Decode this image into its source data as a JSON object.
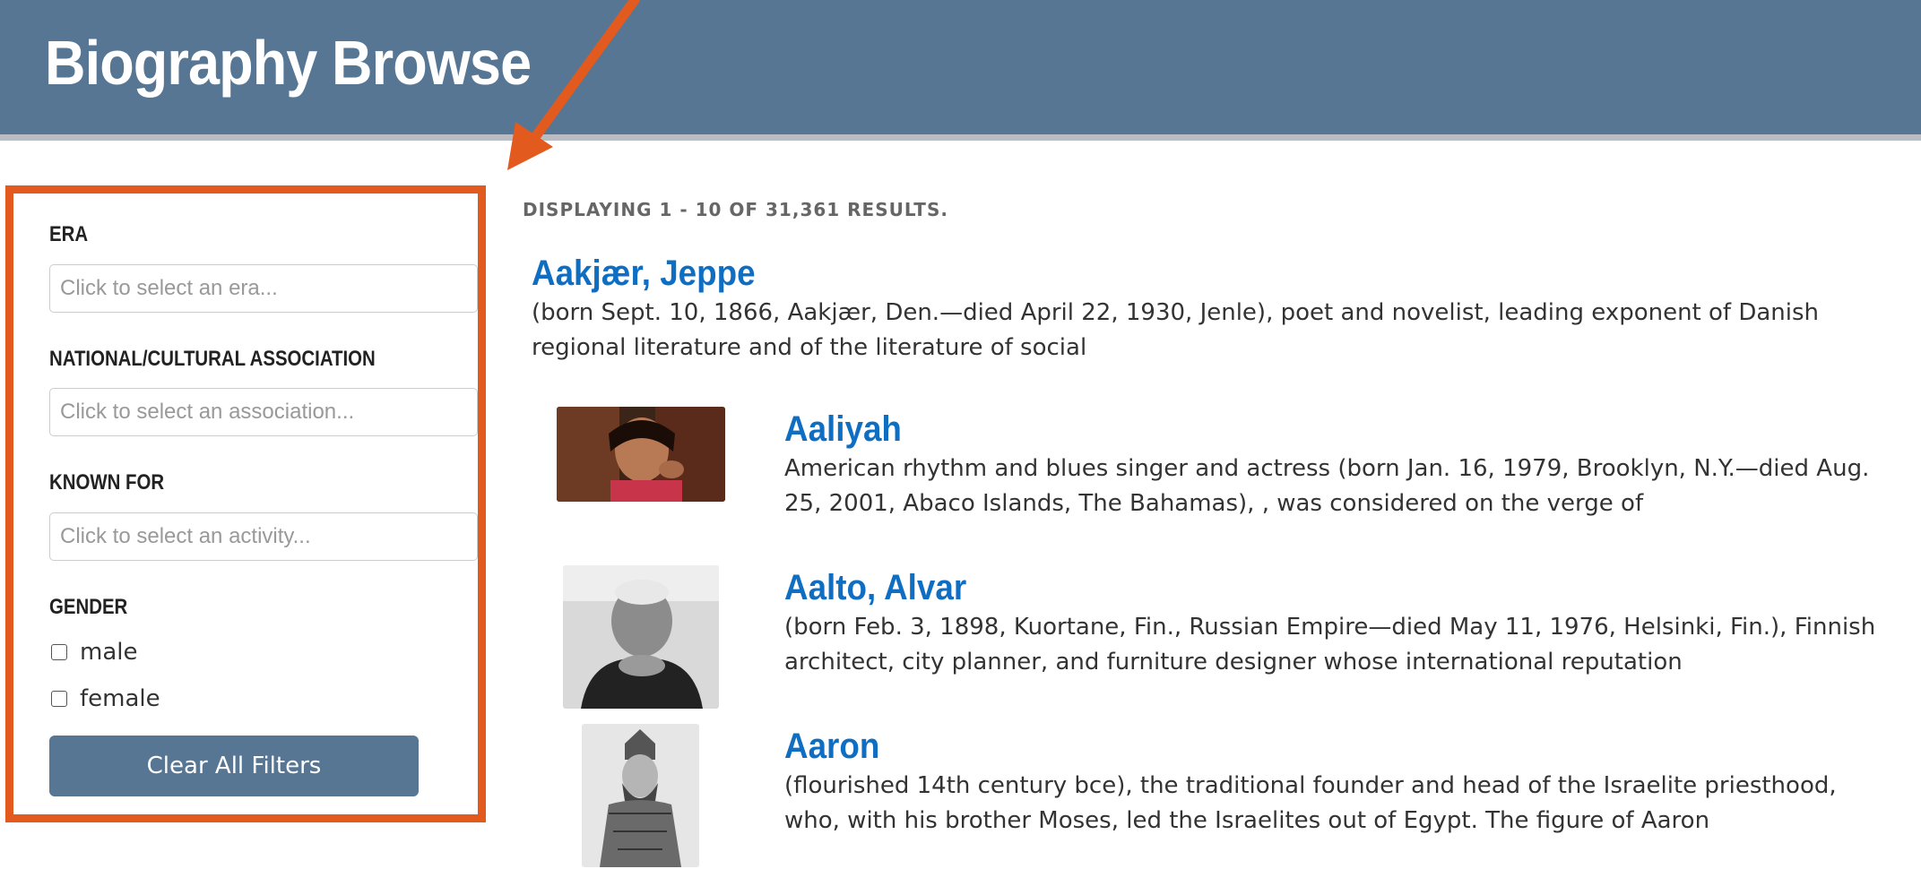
{
  "header": {
    "title": "Biography Browse"
  },
  "filters": {
    "era": {
      "label": "ERA",
      "placeholder": "Click to select an era..."
    },
    "association": {
      "label": "NATIONAL/CULTURAL ASSOCIATION",
      "placeholder": "Click to select an association..."
    },
    "known_for": {
      "label": "KNOWN FOR",
      "placeholder": "Click to select an activity..."
    },
    "gender": {
      "label": "GENDER",
      "options": [
        "male",
        "female"
      ]
    },
    "clear_button": "Clear All Filters"
  },
  "results": {
    "count_text": "DISPLAYING 1 - 10 OF 31,361 RESULTS.",
    "items": [
      {
        "name": "Aakjær, Jeppe",
        "description": "(born Sept. 10, 1866, Aakjær, Den.—died April 22, 1930, Jenle), poet and novelist, leading exponent of Danish regional literature and of the literature of social"
      },
      {
        "name": "Aaliyah",
        "description": "American rhythm and blues singer and actress (born Jan. 16, 1979, Brooklyn, N.Y.—died Aug. 25, 2001, Abaco Islands, The Bahamas), , was considered on the verge of"
      },
      {
        "name": "Aalto, Alvar",
        "description": "(born Feb. 3, 1898, Kuortane, Fin., Russian Empire—died May 11, 1976, Helsinki, Fin.), Finnish architect, city planner, and furniture designer whose international reputation"
      },
      {
        "name": "Aaron",
        "description": "(flourished 14th century bce), the traditional founder and head of the Israelite priesthood, who, with his brother Moses, led the Israelites out of Egypt. The figure of Aaron"
      }
    ]
  },
  "colors": {
    "header_bg": "#567694",
    "highlight": "#e35a1e",
    "link": "#0f6ec2"
  }
}
